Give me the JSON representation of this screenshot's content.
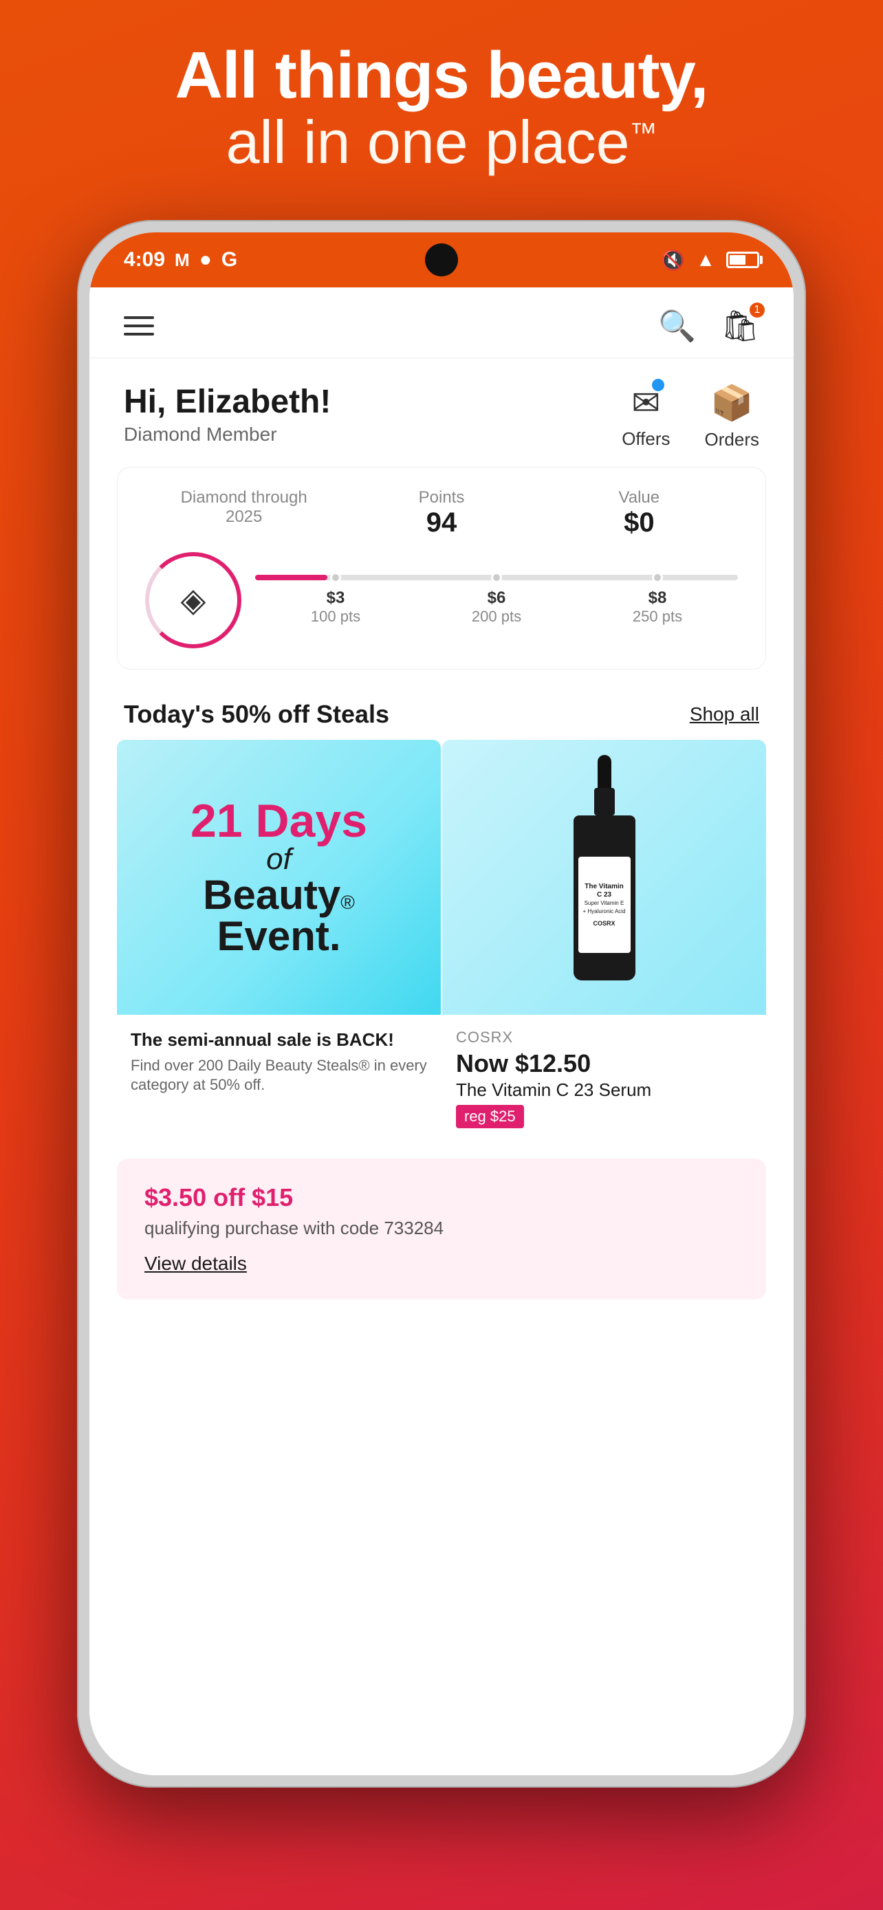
{
  "hero": {
    "line1": "All things beauty,",
    "line2": "all in one place",
    "tm": "™"
  },
  "status_bar": {
    "time": "4:09",
    "icons_left": [
      "M",
      "●",
      "G"
    ],
    "icons_right": [
      "🔇",
      "▲",
      "🔋"
    ]
  },
  "header": {
    "search_label": "Search",
    "cart_count": "1"
  },
  "welcome": {
    "greeting": "Hi, Elizabeth!",
    "membership": "Diamond Member",
    "offers_label": "Offers",
    "orders_label": "Orders"
  },
  "points": {
    "diamond_label": "Diamond through",
    "diamond_year": "2025",
    "points_label": "Points",
    "points_value": "94",
    "value_label": "Value",
    "value_amount": "$0",
    "milestones": [
      {
        "amount": "$3",
        "pts": "100 pts"
      },
      {
        "amount": "$6",
        "pts": "200 pts"
      },
      {
        "amount": "$8",
        "pts": "250 pts"
      }
    ]
  },
  "steals": {
    "title": "Today's 50% off Steals",
    "shop_all": "Shop all",
    "event": {
      "days": "21 Days",
      "of": "of",
      "beauty": "Beauty",
      "event": "Event",
      "period": "."
    },
    "promo_desc_title": "The semi-annual sale is BACK!",
    "promo_desc_body": "Find over 200 Daily Beauty Steals® in every category at 50% off.",
    "product": {
      "brand": "COSRX",
      "price_now": "Now $12.50",
      "name": "The Vitamin C 23 Serum",
      "reg_price": "reg $25",
      "bottle_title": "The Vitamin C 23",
      "bottle_subtitle": "Super Vitamin E + Hyaluronic Acid",
      "bottle_brand": "COSRX"
    }
  },
  "coupon": {
    "title": "$3.50 off $15",
    "desc": "qualifying purchase with code 733284",
    "link": "View details"
  }
}
